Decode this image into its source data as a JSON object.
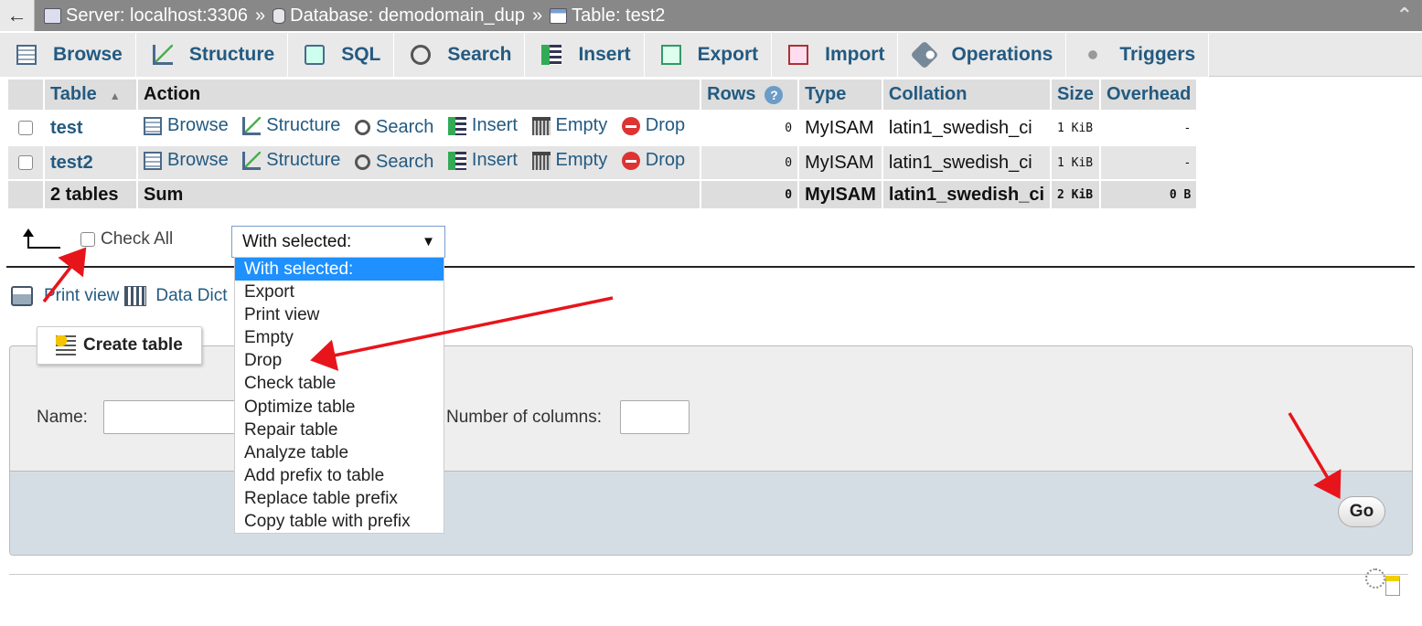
{
  "breadcrumb": {
    "back_label": "←",
    "server": "Server: localhost:3306",
    "database": "Database: demodomain_dup",
    "table": "Table: test2",
    "separator": "»",
    "collapse_label": "⌃"
  },
  "tabs": [
    {
      "label": "Browse",
      "icon": "browse-icon"
    },
    {
      "label": "Structure",
      "icon": "structure-icon"
    },
    {
      "label": "SQL",
      "icon": "sql-icon"
    },
    {
      "label": "Search",
      "icon": "search-icon"
    },
    {
      "label": "Insert",
      "icon": "insert-icon"
    },
    {
      "label": "Export",
      "icon": "export-icon"
    },
    {
      "label": "Import",
      "icon": "import-icon"
    },
    {
      "label": "Operations",
      "icon": "wrench-icon"
    },
    {
      "label": "Triggers",
      "icon": "triggers-icon"
    }
  ],
  "table": {
    "headers": {
      "table": "Table",
      "sort_indicator": "▲",
      "action": "Action",
      "rows": "Rows",
      "rows_help": "?",
      "type": "Type",
      "collation": "Collation",
      "size": "Size",
      "overhead": "Overhead"
    },
    "actions": {
      "browse": "Browse",
      "structure": "Structure",
      "search": "Search",
      "insert": "Insert",
      "empty": "Empty",
      "drop": "Drop"
    },
    "rows": [
      {
        "name": "test",
        "rows": "0",
        "type": "MyISAM",
        "collation": "latin1_swedish_ci",
        "size": "1 KiB",
        "overhead": "-"
      },
      {
        "name": "test2",
        "rows": "0",
        "type": "MyISAM",
        "collation": "latin1_swedish_ci",
        "size": "1 KiB",
        "overhead": "-"
      }
    ],
    "summary": {
      "name": "2 tables",
      "action": "Sum",
      "rows": "0",
      "type": "MyISAM",
      "collation": "latin1_swedish_ci",
      "size": "2 KiB",
      "overhead": "0 B"
    }
  },
  "bulk": {
    "check_all_label": "Check All",
    "select_value": "With selected:",
    "select_arrow": "▼",
    "options": [
      "With selected:",
      "Export",
      "Print view",
      "Empty",
      "Drop",
      "Check table",
      "Optimize table",
      "Repair table",
      "Analyze table",
      "Add prefix to table",
      "Replace table prefix",
      "Copy table with prefix"
    ],
    "highlighted_option": "With selected:"
  },
  "links": {
    "print_view": "Print view",
    "data_dict": "Data Dict"
  },
  "create": {
    "button_label": "Create table",
    "name_label": "Name:",
    "name_value": "",
    "columns_label": "Number of columns:",
    "columns_value": "",
    "go_label": "Go"
  },
  "colors": {
    "link": "#235a81",
    "highlight": "#1e90ff",
    "annotation": "#e8141b"
  }
}
